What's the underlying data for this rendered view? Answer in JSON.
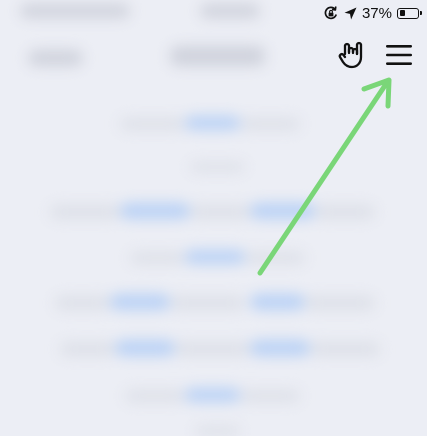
{
  "status_bar": {
    "battery_text": "37%",
    "battery_level": 0.37,
    "icons": [
      "rotation-lock-icon",
      "location-arrow-icon",
      "battery-icon"
    ]
  },
  "toolbar": {
    "icons": [
      "hand-gesture-icon",
      "hamburger-menu-icon"
    ]
  },
  "annotation": {
    "type": "arrow",
    "color": "#7ad678"
  }
}
